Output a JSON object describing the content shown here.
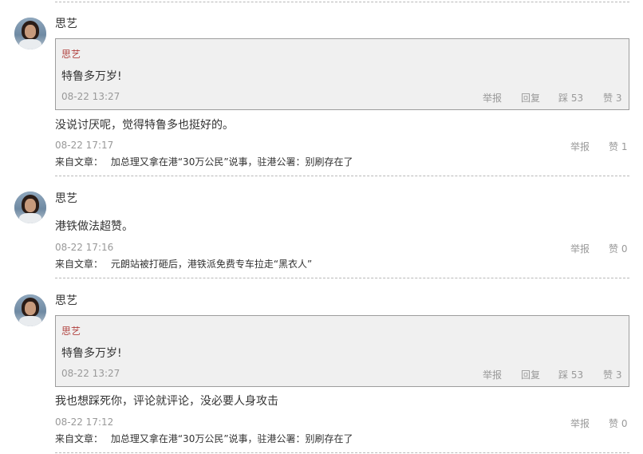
{
  "comments": [
    {
      "user": "思艺",
      "quote": {
        "user": "思艺",
        "text": "特鲁多万岁!",
        "time": "08-22 13:27",
        "report": "举报",
        "reply": "回复",
        "downvote": "踩 53",
        "upvote": "赞 3"
      },
      "text": "没说讨厌呢，觉得特鲁多也挺好的。",
      "time": "08-22 17:17",
      "report": "举报",
      "upvote": "赞 1",
      "source_label": "来自文章：",
      "source_title": "加总理又拿在港“30万公民”说事，驻港公署：别刷存在了"
    },
    {
      "user": "思艺",
      "text": "港铁做法超赞。",
      "time": "08-22 17:16",
      "report": "举报",
      "upvote": "赞 0",
      "source_label": "来自文章：",
      "source_title": "元朗站被打砸后，港铁派免费专车拉走“黑衣人”"
    },
    {
      "user": "思艺",
      "quote": {
        "user": "思艺",
        "text": "特鲁多万岁!",
        "time": "08-22 13:27",
        "report": "举报",
        "reply": "回复",
        "downvote": "踩 53",
        "upvote": "赞 3"
      },
      "text": "我也想踩死你，评论就评论，没必要人身攻击",
      "time": "08-22 17:12",
      "report": "举报",
      "upvote": "赞 0",
      "source_label": "来自文章：",
      "source_title": "加总理又拿在港“30万公民”说事，驻港公署：别刷存在了"
    }
  ]
}
